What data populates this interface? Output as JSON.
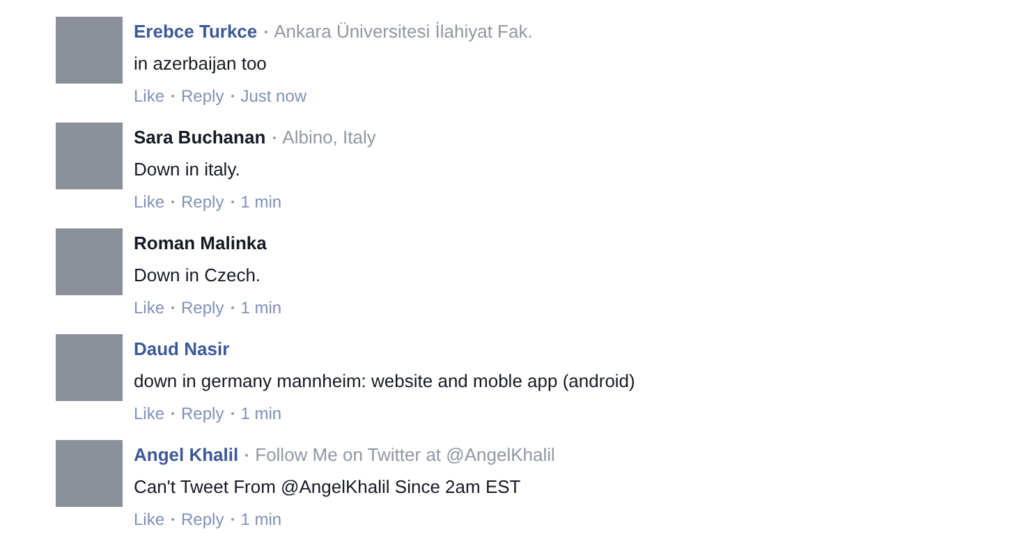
{
  "comments": [
    {
      "author": "Erebce Turkce",
      "color": "#3b5998",
      "subtitle": "Ankara Üniversitesi İlahiyat Fak.",
      "text": "in azerbaijan too",
      "actions": [
        "Like",
        "Reply"
      ],
      "time": "Just now"
    },
    {
      "author": "Sara Buchanan",
      "color": "#141823",
      "subtitle": "Albino, Italy",
      "text": "Down in italy.",
      "actions": [
        "Like",
        "Reply"
      ],
      "time": "1 min"
    },
    {
      "author": "Roman Malinka",
      "color": "#141823",
      "text": "Down in Czech.",
      "actions": [
        "Like",
        "Reply"
      ],
      "time": "1 min"
    },
    {
      "author": "Daud Nasir",
      "color": "#3b5998",
      "text": "down in germany mannheim: website and moble app (android)",
      "actions": [
        "Like",
        "Reply"
      ],
      "time": "1 min"
    },
    {
      "author": "Angel Khalil",
      "color": "#3b5998",
      "subtitle": "Follow Me on Twitter at @AngelKhalil",
      "text": "Can't Tweet From @AngelKhalil Since 2am EST",
      "actions": [
        "Like",
        "Reply"
      ],
      "time": "1 min"
    }
  ]
}
